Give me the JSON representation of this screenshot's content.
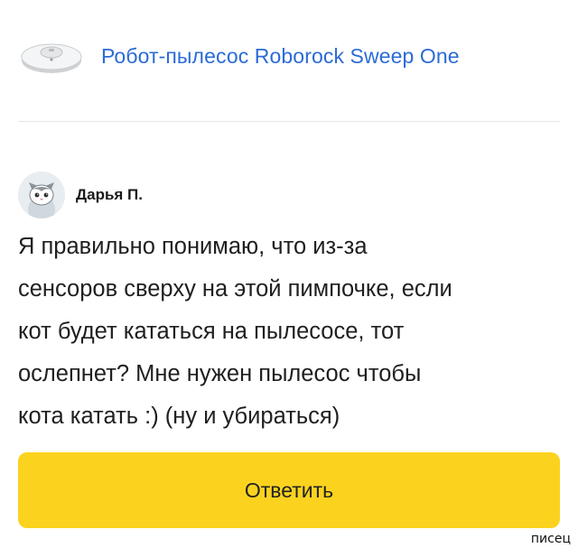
{
  "product": {
    "title": "Робот-пылесос Roborock Sweep One",
    "thumbnail_icon": "robot-vacuum-icon"
  },
  "comment": {
    "author": "Дарья П.",
    "avatar_icon": "cat-avatar-icon",
    "lines": [
      "Я правильно понимаю, что из-за",
      "сенсоров сверху на этой пимпочке, если",
      "кот будет кататься на пылесосе, тот",
      "ослепнет? Мне нужен пылесос чтобы",
      "кота катать :) (ну и убираться)"
    ]
  },
  "actions": {
    "reply_label": "Ответить",
    "reply_color": "#fbd31f"
  },
  "colors": {
    "link": "#2b6bd6"
  },
  "watermark": "писец"
}
